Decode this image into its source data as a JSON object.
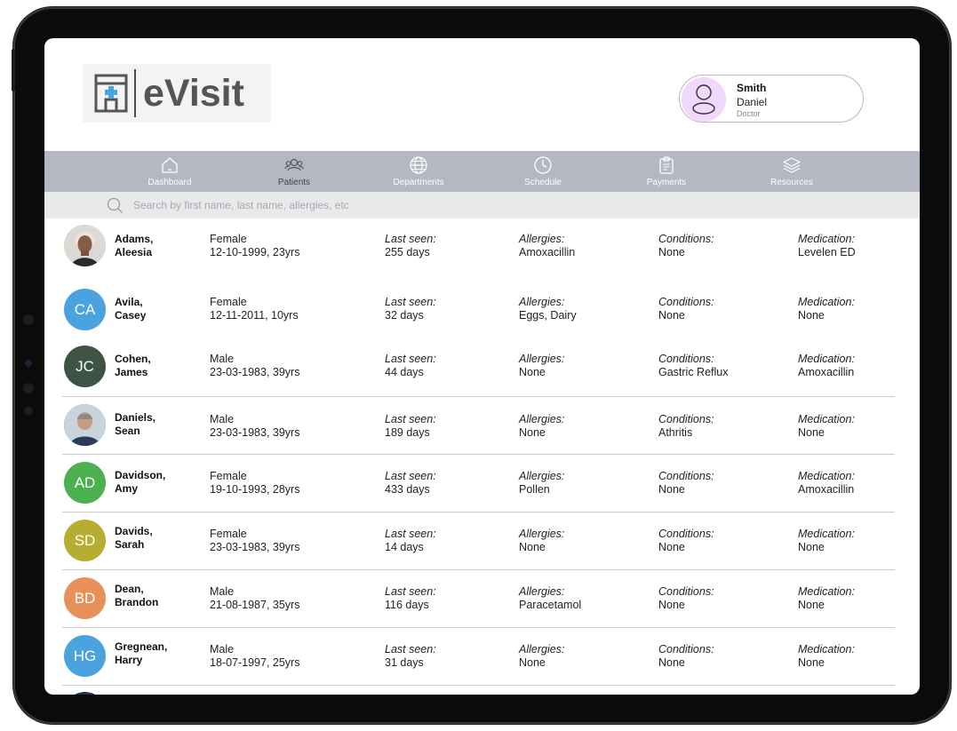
{
  "app": {
    "logo_text": "eVisit"
  },
  "user": {
    "last_name": "Smith",
    "first_name": "Daniel",
    "role": "Doctor"
  },
  "nav": [
    {
      "label": "Dashboard",
      "icon": "home-icon"
    },
    {
      "label": "Patients",
      "icon": "users-icon"
    },
    {
      "label": "Departments",
      "icon": "globe-icon"
    },
    {
      "label": "Schedule",
      "icon": "clock-icon"
    },
    {
      "label": "Payments",
      "icon": "clipboard-icon"
    },
    {
      "label": "Resources",
      "icon": "layers-icon"
    }
  ],
  "search": {
    "placeholder": "Search by first name, last name, allergies, etc"
  },
  "labels": {
    "last_seen": "Last seen:",
    "allergies": "Allergies:",
    "conditions": "Conditions:",
    "medication": "Medication:"
  },
  "patients": [
    {
      "last": "Adams,",
      "first": "Aleesia",
      "initials": "",
      "avatar_color": "#d8d4d0",
      "photo": true,
      "gender": "Female",
      "dob": "12-10-1999, 23yrs",
      "last_seen": "255 days",
      "allergies": "Amoxacillin",
      "conditions": "None",
      "medication": "Levelen ED"
    },
    {
      "last": "Avila,",
      "first": "Casey",
      "initials": "CA",
      "avatar_color": "#4aa3df",
      "photo": false,
      "gender": "Female",
      "dob": "12-11-2011, 10yrs",
      "last_seen": "32 days",
      "allergies": "Eggs, Dairy",
      "conditions": "None",
      "medication": "None"
    },
    {
      "last": "Cohen,",
      "first": "James",
      "initials": "JC",
      "avatar_color": "#3d5445",
      "photo": false,
      "gender": "Male",
      "dob": "23-03-1983, 39yrs",
      "last_seen": "44 days",
      "allergies": "None",
      "conditions": "Gastric Reflux",
      "medication": "Amoxacillin"
    },
    {
      "last": "Daniels,",
      "first": "Sean",
      "initials": "",
      "avatar_color": "#5a6a78",
      "photo": true,
      "gender": "Male",
      "dob": "23-03-1983, 39yrs",
      "last_seen": "189 days",
      "allergies": "None",
      "conditions": "Athritis",
      "medication": "None"
    },
    {
      "last": "Davidson,",
      "first": "Amy",
      "initials": "AD",
      "avatar_color": "#4caf50",
      "photo": false,
      "gender": "Female",
      "dob": "19-10-1993, 28yrs",
      "last_seen": "433 days",
      "allergies": "Pollen",
      "conditions": "None",
      "medication": "Amoxacillin"
    },
    {
      "last": "Davids,",
      "first": "Sarah",
      "initials": "SD",
      "avatar_color": "#b5ae33",
      "photo": false,
      "gender": "Female",
      "dob": "23-03-1983, 39yrs",
      "last_seen": "14 days",
      "allergies": "None",
      "conditions": "None",
      "medication": "None"
    },
    {
      "last": "Dean,",
      "first": "Brandon",
      "initials": "BD",
      "avatar_color": "#e8905a",
      "photo": false,
      "gender": "Male",
      "dob": "21-08-1987, 35yrs",
      "last_seen": "116 days",
      "allergies": "Paracetamol",
      "conditions": "None",
      "medication": "None"
    },
    {
      "last": "Gregnean,",
      "first": "Harry",
      "initials": "HG",
      "avatar_color": "#4aa3df",
      "photo": false,
      "gender": "Male",
      "dob": "18-07-1997, 25yrs",
      "last_seen": "31 days",
      "allergies": "None",
      "conditions": "None",
      "medication": "None"
    }
  ],
  "colors": {
    "nav_bg": "#b3b8c2",
    "search_bg": "#e9e9ec",
    "user_avatar_bg": "#efd8fb",
    "logo_accent": "#4aa3df"
  }
}
